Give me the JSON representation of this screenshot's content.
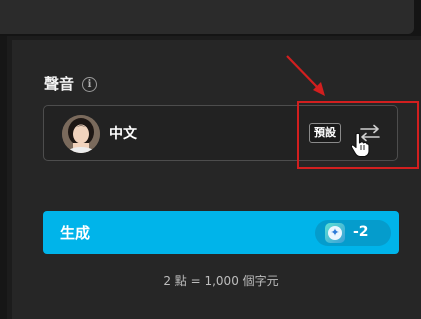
{
  "voice": {
    "label": "聲音",
    "info_icon": "info-icon",
    "selected_name": "中文",
    "badge": "預設",
    "swap_icon": "swap-arrows-icon"
  },
  "generate": {
    "label": "生成",
    "credit_icon": "sparkle-icon",
    "credit_glyph": "✦",
    "credit_cost": "-2"
  },
  "rate_note": "2 點 = 1,000 個字元",
  "colors": {
    "accent": "#00b4ea",
    "highlight": "#d21f1f",
    "background": "#262626"
  }
}
